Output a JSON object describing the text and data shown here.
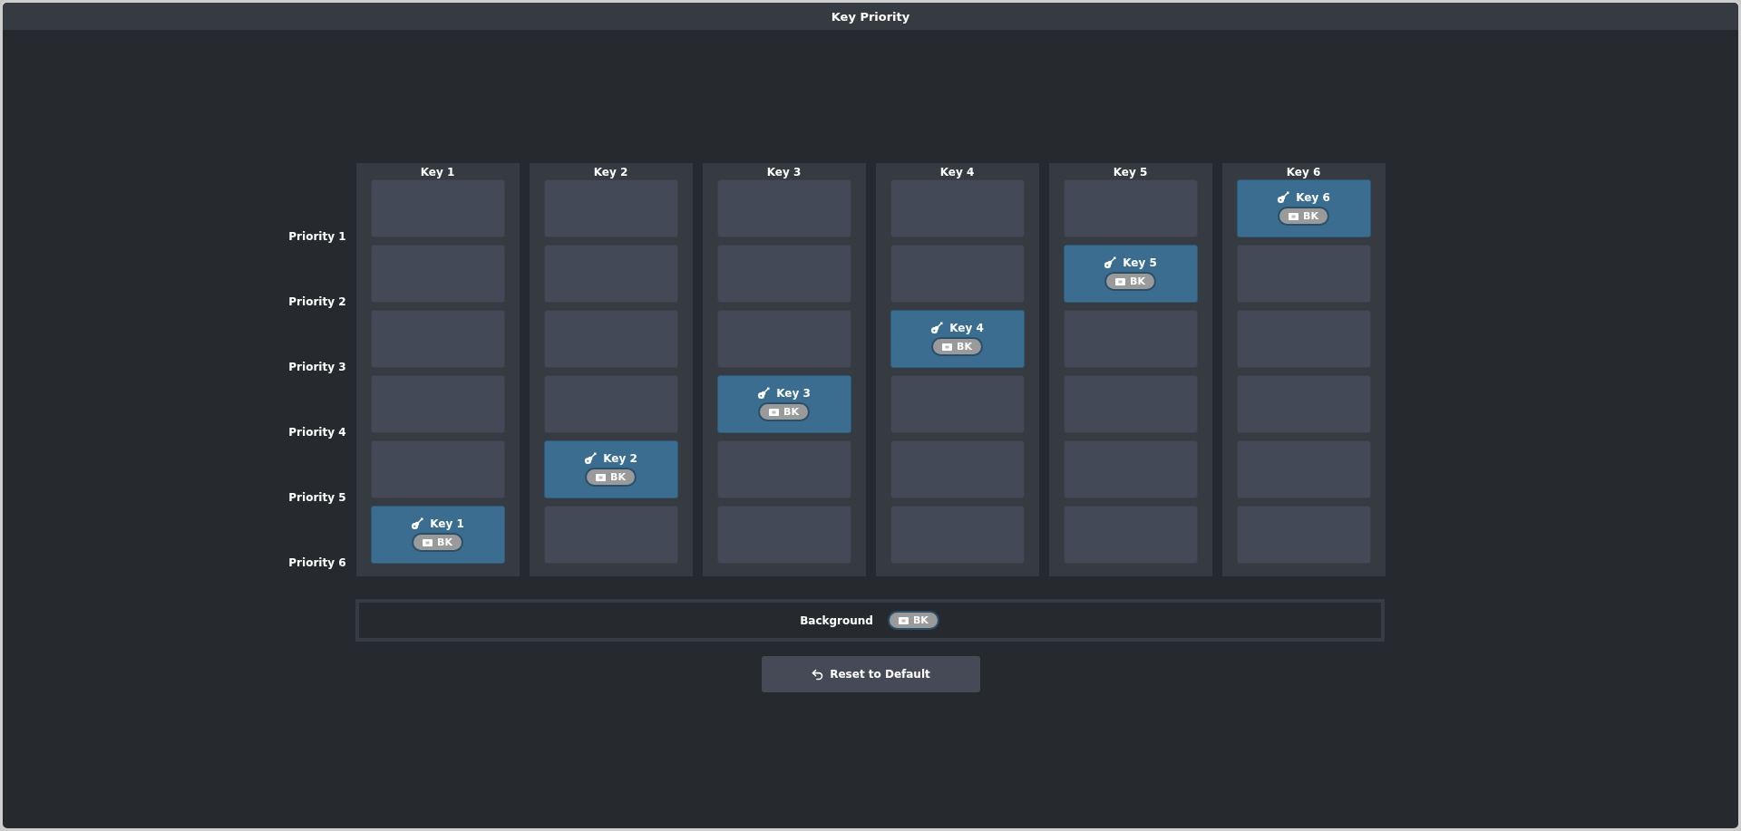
{
  "window": {
    "title": "Key Priority"
  },
  "priority_labels": [
    "Priority 1",
    "Priority 2",
    "Priority 3",
    "Priority 4",
    "Priority 5",
    "Priority 6"
  ],
  "columns": [
    {
      "header": "Key 1",
      "slots": [
        {
          "kind": "empty"
        },
        {
          "kind": "empty"
        },
        {
          "kind": "empty"
        },
        {
          "kind": "empty"
        },
        {
          "kind": "empty"
        },
        {
          "kind": "key",
          "label": "Key 1",
          "source": "BK"
        }
      ]
    },
    {
      "header": "Key 2",
      "slots": [
        {
          "kind": "empty"
        },
        {
          "kind": "empty"
        },
        {
          "kind": "empty"
        },
        {
          "kind": "empty"
        },
        {
          "kind": "key",
          "label": "Key 2",
          "source": "BK"
        },
        {
          "kind": "empty"
        }
      ]
    },
    {
      "header": "Key 3",
      "slots": [
        {
          "kind": "empty"
        },
        {
          "kind": "empty"
        },
        {
          "kind": "empty"
        },
        {
          "kind": "key",
          "label": "Key 3",
          "source": "BK"
        },
        {
          "kind": "empty"
        },
        {
          "kind": "empty"
        }
      ]
    },
    {
      "header": "Key 4",
      "slots": [
        {
          "kind": "empty"
        },
        {
          "kind": "empty"
        },
        {
          "kind": "key",
          "label": "Key 4",
          "source": "BK"
        },
        {
          "kind": "empty"
        },
        {
          "kind": "empty"
        },
        {
          "kind": "empty"
        }
      ]
    },
    {
      "header": "Key 5",
      "slots": [
        {
          "kind": "empty"
        },
        {
          "kind": "key",
          "label": "Key 5",
          "source": "BK"
        },
        {
          "kind": "empty"
        },
        {
          "kind": "empty"
        },
        {
          "kind": "empty"
        },
        {
          "kind": "empty"
        }
      ]
    },
    {
      "header": "Key 6",
      "slots": [
        {
          "kind": "key",
          "label": "Key 6",
          "source": "BK"
        },
        {
          "kind": "empty"
        },
        {
          "kind": "empty"
        },
        {
          "kind": "empty"
        },
        {
          "kind": "empty"
        },
        {
          "kind": "empty"
        }
      ]
    }
  ],
  "background": {
    "label": "Background",
    "source": "BK"
  },
  "reset_button": {
    "label": "Reset to Default"
  }
}
